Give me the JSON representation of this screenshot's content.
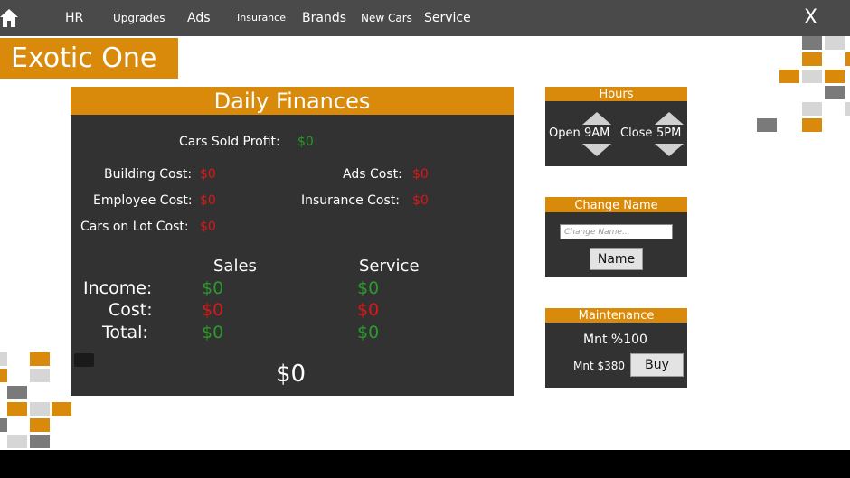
{
  "nav": {
    "items": [
      "HR",
      "Upgrades",
      "Ads",
      "Insurance",
      "Brands",
      "New Cars",
      "Service"
    ],
    "close": "X"
  },
  "dealer": {
    "name": "Exotic One"
  },
  "finances": {
    "title": "Daily Finances",
    "cars_sold_profit_label": "Cars Sold Profit:",
    "cars_sold_profit": "$0",
    "building_cost_label": "Building Cost:",
    "building_cost": "$0",
    "ads_cost_label": "Ads Cost:",
    "ads_cost": "$0",
    "employee_cost_label": "Employee Cost:",
    "employee_cost": "$0",
    "insurance_cost_label": "Insurance Cost:",
    "insurance_cost": "$0",
    "cars_on_lot_cost_label": "Cars on Lot Cost:",
    "cars_on_lot_cost": "$0",
    "sales_header": "Sales",
    "service_header": "Service",
    "income_label": "Income:",
    "cost_label": "Cost:",
    "total_label": "Total:",
    "sales_income": "$0",
    "sales_cost": "$0",
    "sales_total": "$0",
    "service_income": "$0",
    "service_cost": "$0",
    "service_total": "$0",
    "grand_total": "$0"
  },
  "hours": {
    "title": "Hours",
    "open_label": "Open",
    "open_value": "9AM",
    "close_label": "Close",
    "close_value": "5PM"
  },
  "change_name": {
    "title": "Change Name",
    "placeholder": "Change Name...",
    "button": "Name"
  },
  "maintenance": {
    "title": "Maintenance",
    "level": "Mnt %100",
    "price": "Mnt $380",
    "button": "Buy"
  },
  "colors": {
    "accent": "#d98a0b",
    "panel": "#323232",
    "navbar": "#4a4a4a",
    "positive": "#2a9a2a",
    "negative": "#e01515"
  },
  "icons": {
    "home": "home-icon",
    "close": "close-icon"
  }
}
